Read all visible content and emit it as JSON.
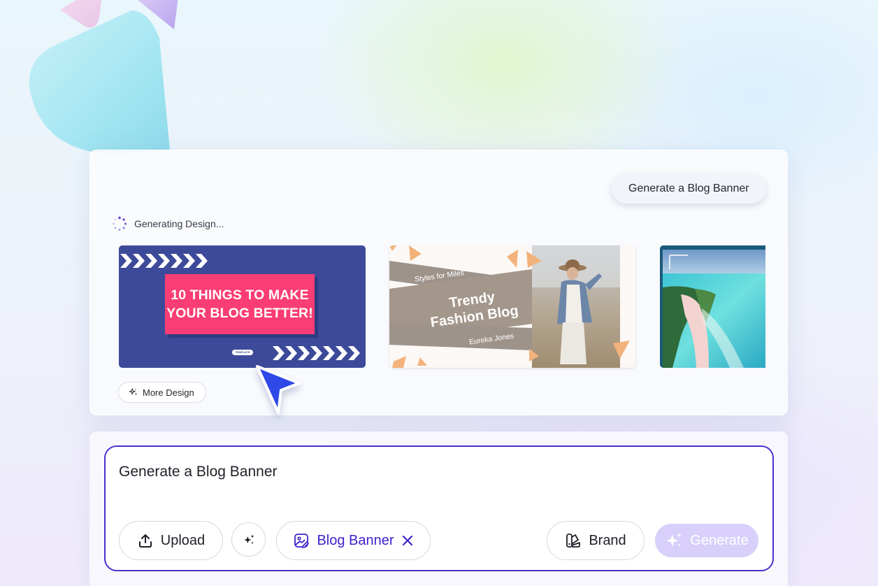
{
  "panel": {
    "prompt_chip": "Generate a Blog Banner",
    "status": "Generating Design...",
    "more_design": "More Design"
  },
  "designs": [
    {
      "headline_line1": "10 THINGS TO MAKE",
      "headline_line2": "YOUR BLOG BETTER!",
      "logo_text": "TEMPLATE"
    },
    {
      "tagline": "Styles for Miles",
      "title_line1": "Trendy",
      "title_line2": "Fashion Blog",
      "author": "Eureka Jones"
    },
    {}
  ],
  "composer": {
    "prompt": "Generate a Blog Banner",
    "upload_label": "Upload",
    "tag_label": "Blog Banner",
    "brand_label": "Brand",
    "generate_label": "Generate"
  },
  "colors": {
    "accent": "#4b2fd0",
    "tag_text": "#4120cc",
    "banner_blue": "#3d4a9a",
    "banner_pink": "#fa3d74",
    "generate_disabled": "#d8d0fb"
  },
  "icons": {
    "spinner": "loading-spinner-icon",
    "sparkle": "sparkle-icon",
    "upload": "upload-icon",
    "image": "image-edit-icon",
    "close": "close-icon",
    "brand": "brand-palette-icon",
    "cursor": "cursor-arrow-icon"
  }
}
